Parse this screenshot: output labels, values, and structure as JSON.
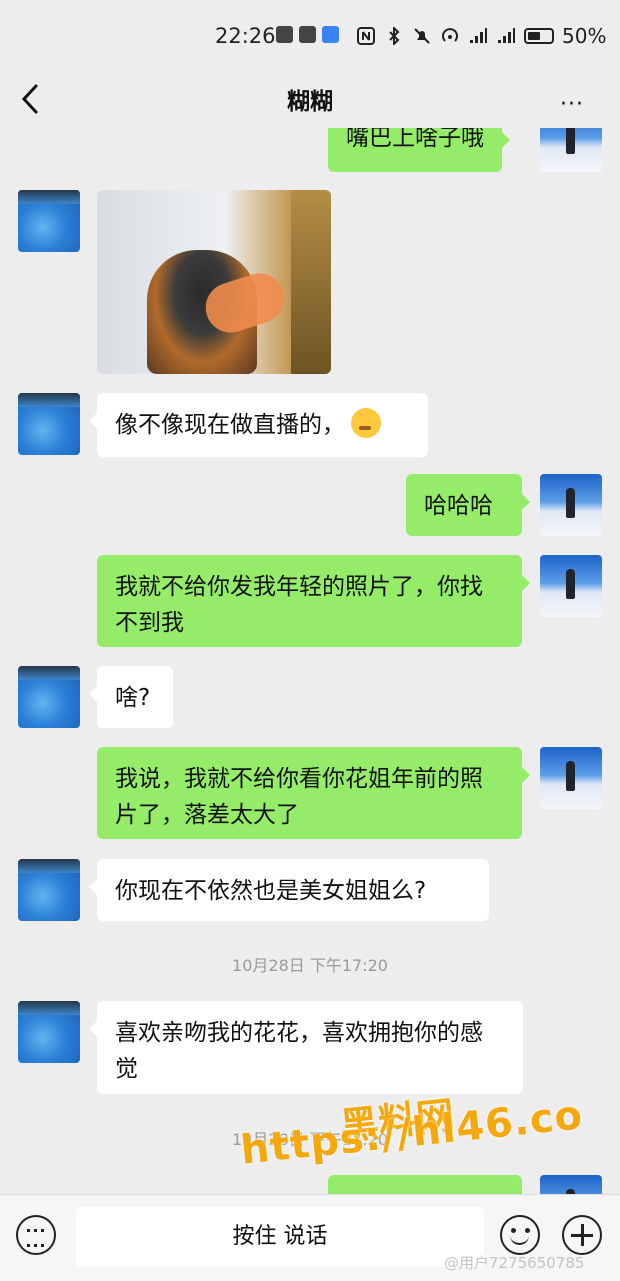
{
  "status_bar": {
    "time": "22:26",
    "battery": "50%",
    "network": "4G"
  },
  "nav": {
    "title": "糊糊",
    "more": "···"
  },
  "messages": [
    {
      "side": "right",
      "text": "嘴巴上啥子哦"
    },
    {
      "side": "left",
      "type": "image"
    },
    {
      "side": "left",
      "text": "像不像现在做直播的，"
    },
    {
      "side": "right",
      "text": "哈哈哈"
    },
    {
      "side": "right",
      "text": "我就不给你发我年轻的照片了，你找不到我"
    },
    {
      "side": "left",
      "text": "啥?"
    },
    {
      "side": "right",
      "text": "我说，我就不给你看你花姐年前的照片了，落差太大了"
    },
    {
      "side": "left",
      "text": "你现在不依然也是美女姐姐么?"
    },
    {
      "side": "left",
      "text": "喜欢亲吻我的花花，喜欢拥抱你的感觉"
    }
  ],
  "timestamps": [
    "10月28日 下午17:20",
    "10月28日 下午17:20"
  ],
  "input": {
    "talk_label": "按住 说话"
  },
  "watermark": {
    "title": "黑料网",
    "url": "https://hl46.co",
    "user": "@用户7275650785"
  },
  "icons": {
    "back": "chevron-left-icon",
    "more": "more-icon",
    "keyboard": "keyboard-icon",
    "emoji": "emoji-icon",
    "plus": "plus-icon"
  },
  "colors": {
    "background": "#ededed",
    "bubble_right": "#95ec69",
    "bubble_left": "#ffffff",
    "watermark": "#f5a80c"
  }
}
